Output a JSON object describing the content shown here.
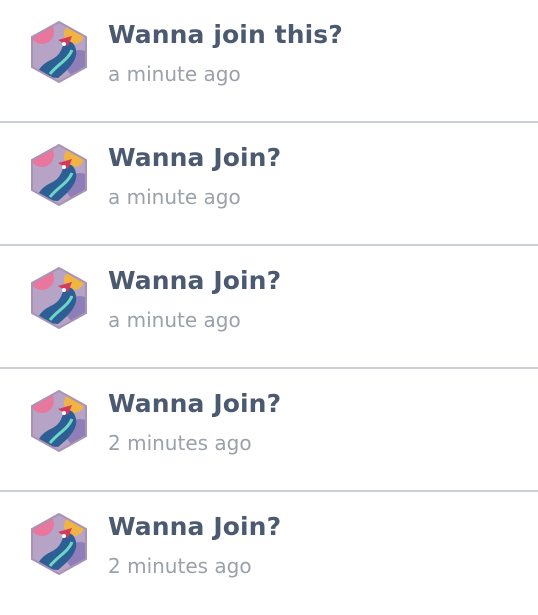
{
  "notifications": [
    {
      "title": "Wanna join this?",
      "time": "a minute ago"
    },
    {
      "title": "Wanna Join?",
      "time": "a minute ago"
    },
    {
      "title": "Wanna Join?",
      "time": "a minute ago"
    },
    {
      "title": "Wanna Join?",
      "time": "2 minutes ago"
    },
    {
      "title": "Wanna Join?",
      "time": "2 minutes ago"
    }
  ],
  "avatar": {
    "icon": "dragon-avatar-icon",
    "frame_color": "#b9a6c4",
    "colors": [
      "#e04b7c",
      "#3a6fb0",
      "#6ed6c6",
      "#f0b445",
      "#2b3f6a"
    ]
  }
}
